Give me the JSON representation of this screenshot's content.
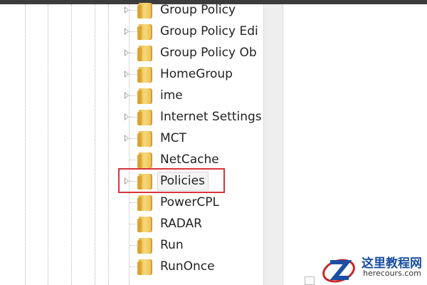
{
  "registry_tree": {
    "items": [
      {
        "label": "Group Policy",
        "expandable": true,
        "selected": false
      },
      {
        "label": "Group Policy Edi",
        "expandable": true,
        "selected": false
      },
      {
        "label": "Group Policy Ob",
        "expandable": true,
        "selected": false
      },
      {
        "label": "HomeGroup",
        "expandable": true,
        "selected": false
      },
      {
        "label": "ime",
        "expandable": true,
        "selected": false
      },
      {
        "label": "Internet Settings",
        "expandable": true,
        "selected": false
      },
      {
        "label": "MCT",
        "expandable": true,
        "selected": false
      },
      {
        "label": "NetCache",
        "expandable": false,
        "selected": false
      },
      {
        "label": "Policies",
        "expandable": true,
        "selected": true
      },
      {
        "label": "PowerCPL",
        "expandable": false,
        "selected": false
      },
      {
        "label": "RADAR",
        "expandable": false,
        "selected": false
      },
      {
        "label": "Run",
        "expandable": false,
        "selected": false
      },
      {
        "label": "RunOnce",
        "expandable": false,
        "selected": false
      }
    ]
  },
  "annotation": {
    "highlight_color": "#d9343c"
  },
  "watermark": {
    "title": "这里教程网",
    "url": "herecours.com",
    "icon": "z-logo-icon"
  },
  "colors": {
    "folder": "#f2c955",
    "tree_line": "#b8b8b8",
    "scrollbar": "#eeeeee"
  }
}
